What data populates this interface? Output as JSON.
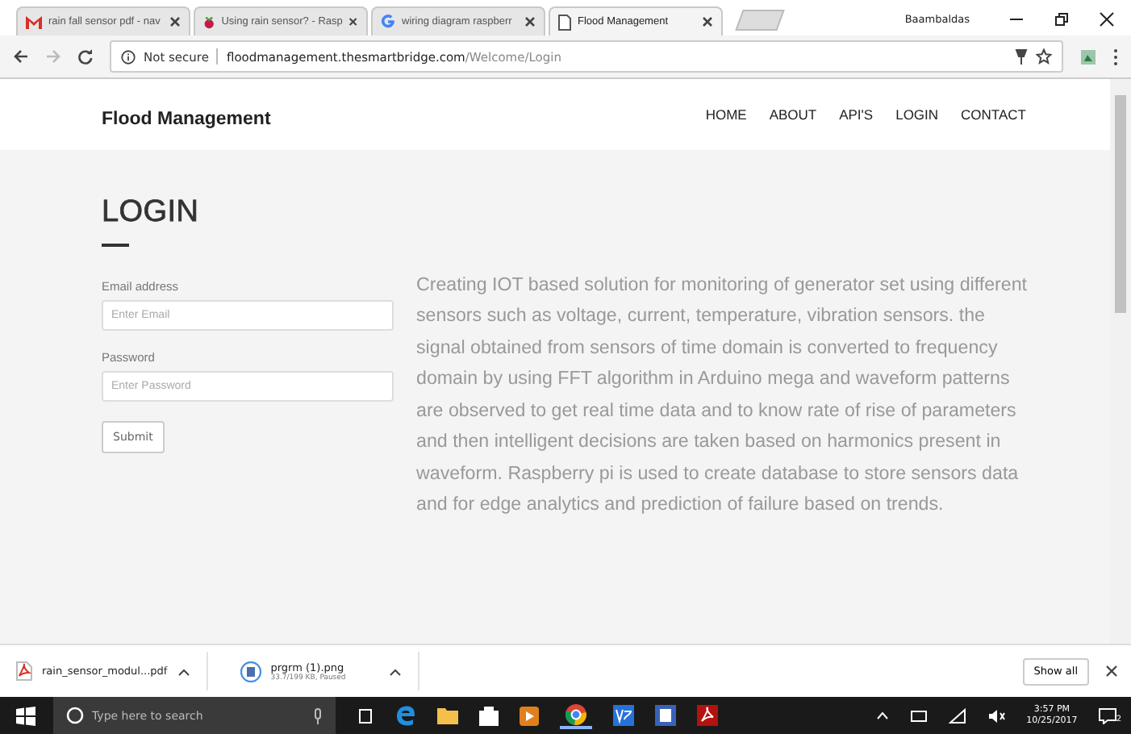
{
  "browser": {
    "tabs": [
      {
        "title": "rain fall sensor pdf - nav",
        "selected": false
      },
      {
        "title": "Using rain sensor? - Rasp",
        "selected": false
      },
      {
        "title": "wiring diagram raspberr",
        "selected": false
      },
      {
        "title": "Flood Management",
        "selected": true
      }
    ],
    "user": "Baambaldas",
    "security": "Not secure",
    "url_host": "floodmanagement.thesmartbridge.com",
    "url_path": "/Welcome/Login"
  },
  "site": {
    "brand": "Flood Management",
    "nav": [
      {
        "label": "HOME",
        "selected": false
      },
      {
        "label": "ABOUT",
        "selected": false
      },
      {
        "label": "API'S",
        "selected": false
      },
      {
        "label": "LOGIN",
        "selected": false
      },
      {
        "label": "CONTACT",
        "selected": false
      }
    ],
    "heading": "LOGIN",
    "form": {
      "email_label": "Email address",
      "email_placeholder": "Enter Email",
      "password_label": "Password",
      "password_placeholder": "Enter Password",
      "submit": "Submit"
    },
    "description": "Creating IOT based solution for monitoring of generator set using different sensors such as voltage, current, temperature, vibration sensors. the signal obtained from sensors of time domain is converted to frequency domain by using FFT algorithm in Arduino mega and waveform patterns are observed to get real time data and to know rate of rise of parameters and then intelligent decisions are taken based on harmonics present in waveform. Raspberry pi is used to create database to store sensors data and for edge analytics and prediction of failure based on trends."
  },
  "downloads": {
    "items": [
      {
        "name": "rain_sensor_modul...pdf",
        "kind": "pdf"
      },
      {
        "name": "prgrm (1).png",
        "status": "33.7/199 KB, Paused",
        "kind": "image"
      }
    ],
    "show_all": "Show all"
  },
  "taskbar": {
    "search_placeholder": "Type here to search",
    "time": "3:57 PM",
    "date": "10/25/2017",
    "notifications": "2"
  }
}
